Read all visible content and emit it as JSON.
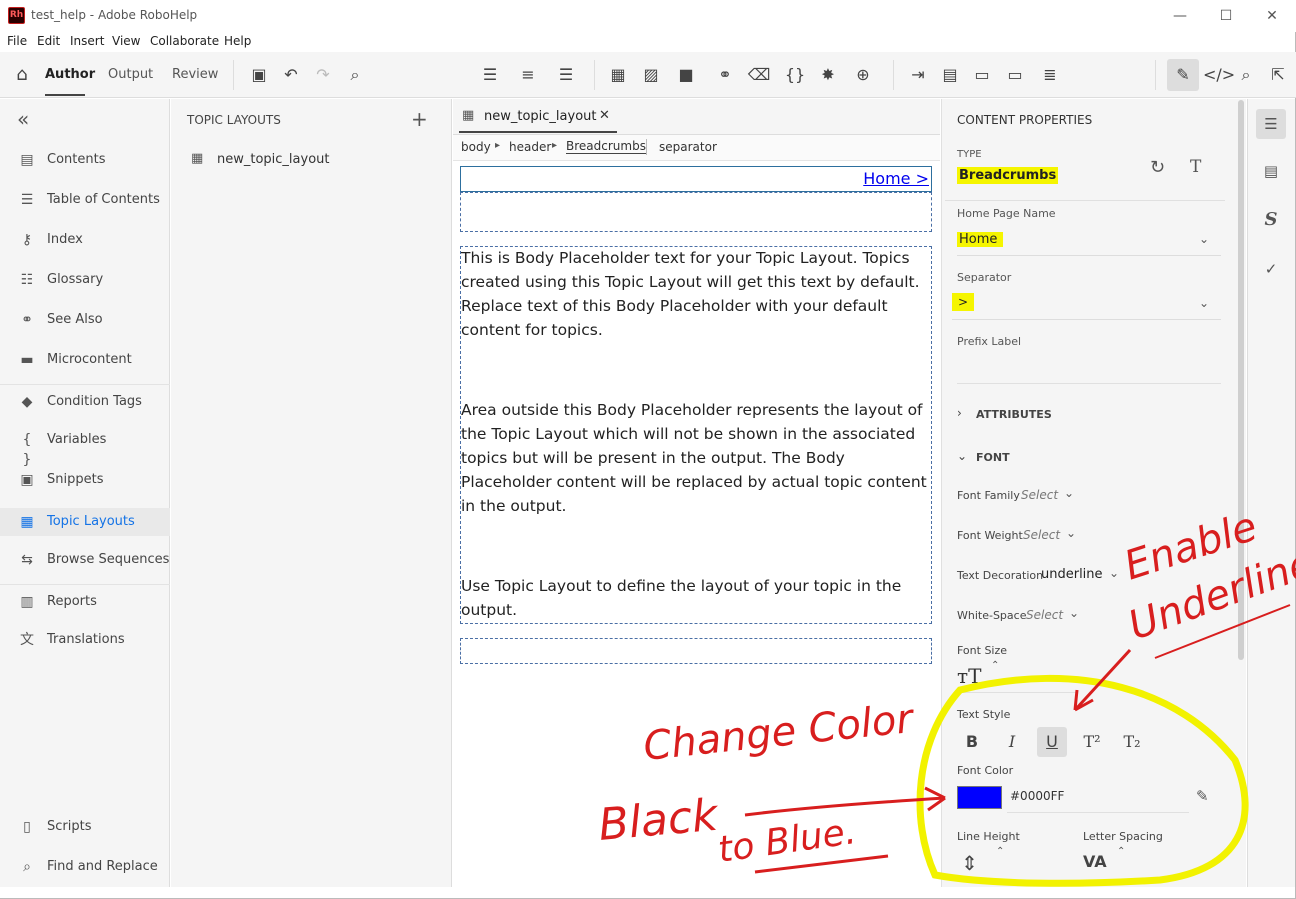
{
  "window": {
    "title": "test_help - Adobe RoboHelp",
    "logo": "Rh",
    "minimize": "—",
    "maximize": "☐",
    "close": "✕"
  },
  "menu": [
    "File",
    "Edit",
    "Insert",
    "View",
    "Collaborate",
    "Help"
  ],
  "toolbar": {
    "tabs": [
      "Author",
      "Output",
      "Review"
    ],
    "active_tab": "Author"
  },
  "leftnav": {
    "collapse_icon": "«",
    "items": [
      {
        "label": "Contents",
        "icon": "contents-icon"
      },
      {
        "label": "Table of Contents",
        "icon": "toc-icon"
      },
      {
        "label": "Index",
        "icon": "key-icon"
      },
      {
        "label": "Glossary",
        "icon": "glossary-icon"
      },
      {
        "label": "See Also",
        "icon": "see-also-icon"
      },
      {
        "label": "Microcontent",
        "icon": "microcontent-icon"
      },
      {
        "label": "Condition Tags",
        "icon": "tag-icon"
      },
      {
        "label": "Variables",
        "icon": "braces-icon"
      },
      {
        "label": "Snippets",
        "icon": "snippet-icon"
      },
      {
        "label": "Topic Layouts",
        "icon": "layout-icon"
      },
      {
        "label": "Browse Sequences",
        "icon": "sequence-icon"
      },
      {
        "label": "Reports",
        "icon": "report-icon"
      },
      {
        "label": "Translations",
        "icon": "translate-icon"
      },
      {
        "label": "Scripts",
        "icon": "script-icon"
      },
      {
        "label": "Find and Replace",
        "icon": "find-replace-icon"
      }
    ],
    "active": "Topic Layouts"
  },
  "topic_layouts": {
    "heading": "TOPIC LAYOUTS",
    "add": "+",
    "items": [
      "new_topic_layout"
    ]
  },
  "editor": {
    "tab_label": "new_topic_layout",
    "tab_close": "✕",
    "breadcrumb": [
      "body",
      "header",
      "Breadcrumbs"
    ],
    "breadcrumb_sep": "▸",
    "breadcrumb_extra": "separator",
    "home_link": "Home >",
    "paragraphs": [
      "This is Body Placeholder text for your Topic Layout. Topics created using this Topic Layout will get this text by default. Replace text of this Body Placeholder with your default content for topics.",
      "Area outside this Body Placeholder represents the layout of the Topic Layout which will not be shown in the associated topics but will be present in the output. The Body Placeholder content will be replaced by actual topic content in the output.",
      "Use Topic Layout to define the layout of your topic in the output."
    ]
  },
  "props": {
    "heading": "CONTENT PROPERTIES",
    "type_label": "TYPE",
    "type_value": "Breadcrumbs",
    "home_page_label": "Home Page Name",
    "home_page_value": "Home",
    "separator_label": "Separator",
    "separator_value": ">",
    "prefix_label": "Prefix Label",
    "attributes": "ATTRIBUTES",
    "font": "FONT",
    "font_family_label": "Font Family",
    "font_weight_label": "Font Weight",
    "text_decoration_label": "Text Decoration",
    "text_decoration_value": "underline",
    "white_space_label": "White-Space",
    "select_placeholder": "Select",
    "font_size_label": "Font Size",
    "text_style_label": "Text Style",
    "text_style_buttons": [
      "B",
      "I",
      "U",
      "T²",
      "T₂"
    ],
    "font_color_label": "Font Color",
    "font_color_value": "#0000FF",
    "swatch_color": "#0000FF",
    "line_height_label": "Line Height",
    "letter_spacing_label": "Letter Spacing"
  },
  "annotations": {
    "enable": "Enable",
    "underline": "Underline",
    "change_color": "Change Color",
    "black": "Black",
    "to_blue": "to Blue."
  },
  "colors": {
    "accent": "#1473e6",
    "highlight": "#f5f500",
    "annotation": "#d81e1e"
  }
}
